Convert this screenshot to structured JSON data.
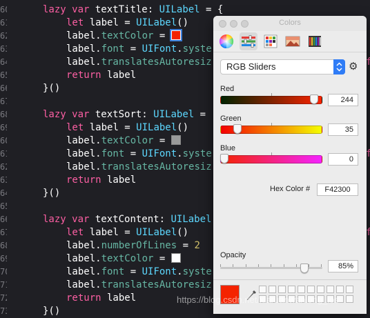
{
  "editor": {
    "lines": [
      {
        "n": "60",
        "tokens": [
          [
            "kw",
            "lazy"
          ],
          [
            "pl",
            " "
          ],
          [
            "kw",
            "var"
          ],
          [
            "pl",
            " textTitle: "
          ],
          [
            "ty",
            "UILabel"
          ],
          [
            "pl",
            " = {"
          ]
        ],
        "indent": 0
      },
      {
        "n": "61",
        "tokens": [
          [
            "kw",
            "let"
          ],
          [
            "pl",
            " label = "
          ],
          [
            "ty",
            "UILabel"
          ],
          [
            "pl",
            "()"
          ]
        ],
        "indent": 1
      },
      {
        "n": "62",
        "tokens": [
          [
            "pl",
            "label."
          ],
          [
            "pr",
            "textColor"
          ],
          [
            "pl",
            " = "
          ]
        ],
        "indent": 1,
        "swatch": "#f42300",
        "swatch_selected": true
      },
      {
        "n": "63",
        "tokens": [
          [
            "pl",
            "label."
          ],
          [
            "pr",
            "font"
          ],
          [
            "pl",
            " = "
          ],
          [
            "ty",
            "UIFont"
          ],
          [
            "pl",
            "."
          ],
          [
            "pr",
            "syste"
          ]
        ],
        "indent": 1
      },
      {
        "n": "64",
        "tokens": [
          [
            "pl",
            "label."
          ],
          [
            "pr",
            "translatesAutoresiz"
          ]
        ],
        "indent": 1
      },
      {
        "n": "65",
        "tokens": [
          [
            "kw",
            "return"
          ],
          [
            "pl",
            " label"
          ]
        ],
        "indent": 1
      },
      {
        "n": "66",
        "tokens": [
          [
            "pl",
            "}()"
          ]
        ],
        "indent": 0
      },
      {
        "n": "67",
        "tokens": [],
        "indent": 0
      },
      {
        "n": "68",
        "tokens": [
          [
            "kw",
            "lazy"
          ],
          [
            "pl",
            " "
          ],
          [
            "kw",
            "var"
          ],
          [
            "pl",
            " textSort: "
          ],
          [
            "ty",
            "UILabel"
          ],
          [
            "pl",
            " ="
          ]
        ],
        "indent": 0
      },
      {
        "n": "69",
        "tokens": [
          [
            "kw",
            "let"
          ],
          [
            "pl",
            " label = "
          ],
          [
            "ty",
            "UILabel"
          ],
          [
            "pl",
            "()"
          ]
        ],
        "indent": 1
      },
      {
        "n": "60",
        "tokens": [
          [
            "pl",
            "label."
          ],
          [
            "pr",
            "textColor"
          ],
          [
            "pl",
            " = "
          ]
        ],
        "indent": 1,
        "swatch": "#9a9a9a"
      },
      {
        "n": "61",
        "tokens": [
          [
            "pl",
            "label."
          ],
          [
            "pr",
            "font"
          ],
          [
            "pl",
            " = "
          ],
          [
            "ty",
            "UIFont"
          ],
          [
            "pl",
            "."
          ],
          [
            "pr",
            "syste"
          ]
        ],
        "indent": 1
      },
      {
        "n": "62",
        "tokens": [
          [
            "pl",
            "label."
          ],
          [
            "pr",
            "translatesAutoresiz"
          ]
        ],
        "indent": 1
      },
      {
        "n": "63",
        "tokens": [
          [
            "kw",
            "return"
          ],
          [
            "pl",
            " label"
          ]
        ],
        "indent": 1
      },
      {
        "n": "64",
        "tokens": [
          [
            "pl",
            "}()"
          ]
        ],
        "indent": 0
      },
      {
        "n": "65",
        "tokens": [],
        "indent": 0
      },
      {
        "n": "66",
        "tokens": [
          [
            "kw",
            "lazy"
          ],
          [
            "pl",
            " "
          ],
          [
            "kw",
            "var"
          ],
          [
            "pl",
            " textContent: "
          ],
          [
            "ty",
            "UILabel"
          ]
        ],
        "indent": 0
      },
      {
        "n": "67",
        "tokens": [
          [
            "kw",
            "let"
          ],
          [
            "pl",
            " label = "
          ],
          [
            "ty",
            "UILabel"
          ],
          [
            "pl",
            "()"
          ]
        ],
        "indent": 1
      },
      {
        "n": "68",
        "tokens": [
          [
            "pl",
            "label."
          ],
          [
            "pr",
            "numberOfLines"
          ],
          [
            "pl",
            " = "
          ],
          [
            "num",
            "2"
          ]
        ],
        "indent": 1
      },
      {
        "n": "69",
        "tokens": [
          [
            "pl",
            "label."
          ],
          [
            "pr",
            "textColor"
          ],
          [
            "pl",
            " = "
          ]
        ],
        "indent": 1,
        "swatch": "#ffffff"
      },
      {
        "n": "70",
        "tokens": [
          [
            "pl",
            "label."
          ],
          [
            "pr",
            "font"
          ],
          [
            "pl",
            " = "
          ],
          [
            "ty",
            "UIFont"
          ],
          [
            "pl",
            "."
          ],
          [
            "pr",
            "syste"
          ]
        ],
        "indent": 1
      },
      {
        "n": "71",
        "tokens": [
          [
            "pl",
            "label."
          ],
          [
            "pr",
            "translatesAutoresiz"
          ]
        ],
        "indent": 1
      },
      {
        "n": "72",
        "tokens": [
          [
            "kw",
            "return"
          ],
          [
            "pl",
            " label"
          ]
        ],
        "indent": 1
      },
      {
        "n": "73",
        "tokens": [
          [
            "pl",
            "}()"
          ]
        ],
        "indent": 0
      }
    ],
    "right_edge_char": "f"
  },
  "colors_panel": {
    "title": "Colors",
    "toolbar": [
      "color-wheel",
      "color-sliders",
      "color-palettes",
      "image-palettes",
      "crayons"
    ],
    "mode": "RGB Sliders",
    "sliders": [
      {
        "label": "Red",
        "value": "244",
        "fraction": 0.957,
        "gradient": "linear-gradient(to right,#002300,#ff2300)"
      },
      {
        "label": "Green",
        "value": "35",
        "fraction": 0.137,
        "gradient": "linear-gradient(to right,#f40000,#f4ff00)"
      },
      {
        "label": "Blue",
        "value": "0",
        "fraction": 0.0,
        "gradient": "linear-gradient(to right,#f42300,#f423ff)"
      }
    ],
    "hex_label": "Hex Color #",
    "hex_value": "F42300",
    "opacity_label": "Opacity",
    "opacity_value": "85%",
    "opacity_fraction": 0.85,
    "current_color": "#f42300"
  },
  "watermark": "https://blog.csdn.net/xiaruanwanlong_ios"
}
